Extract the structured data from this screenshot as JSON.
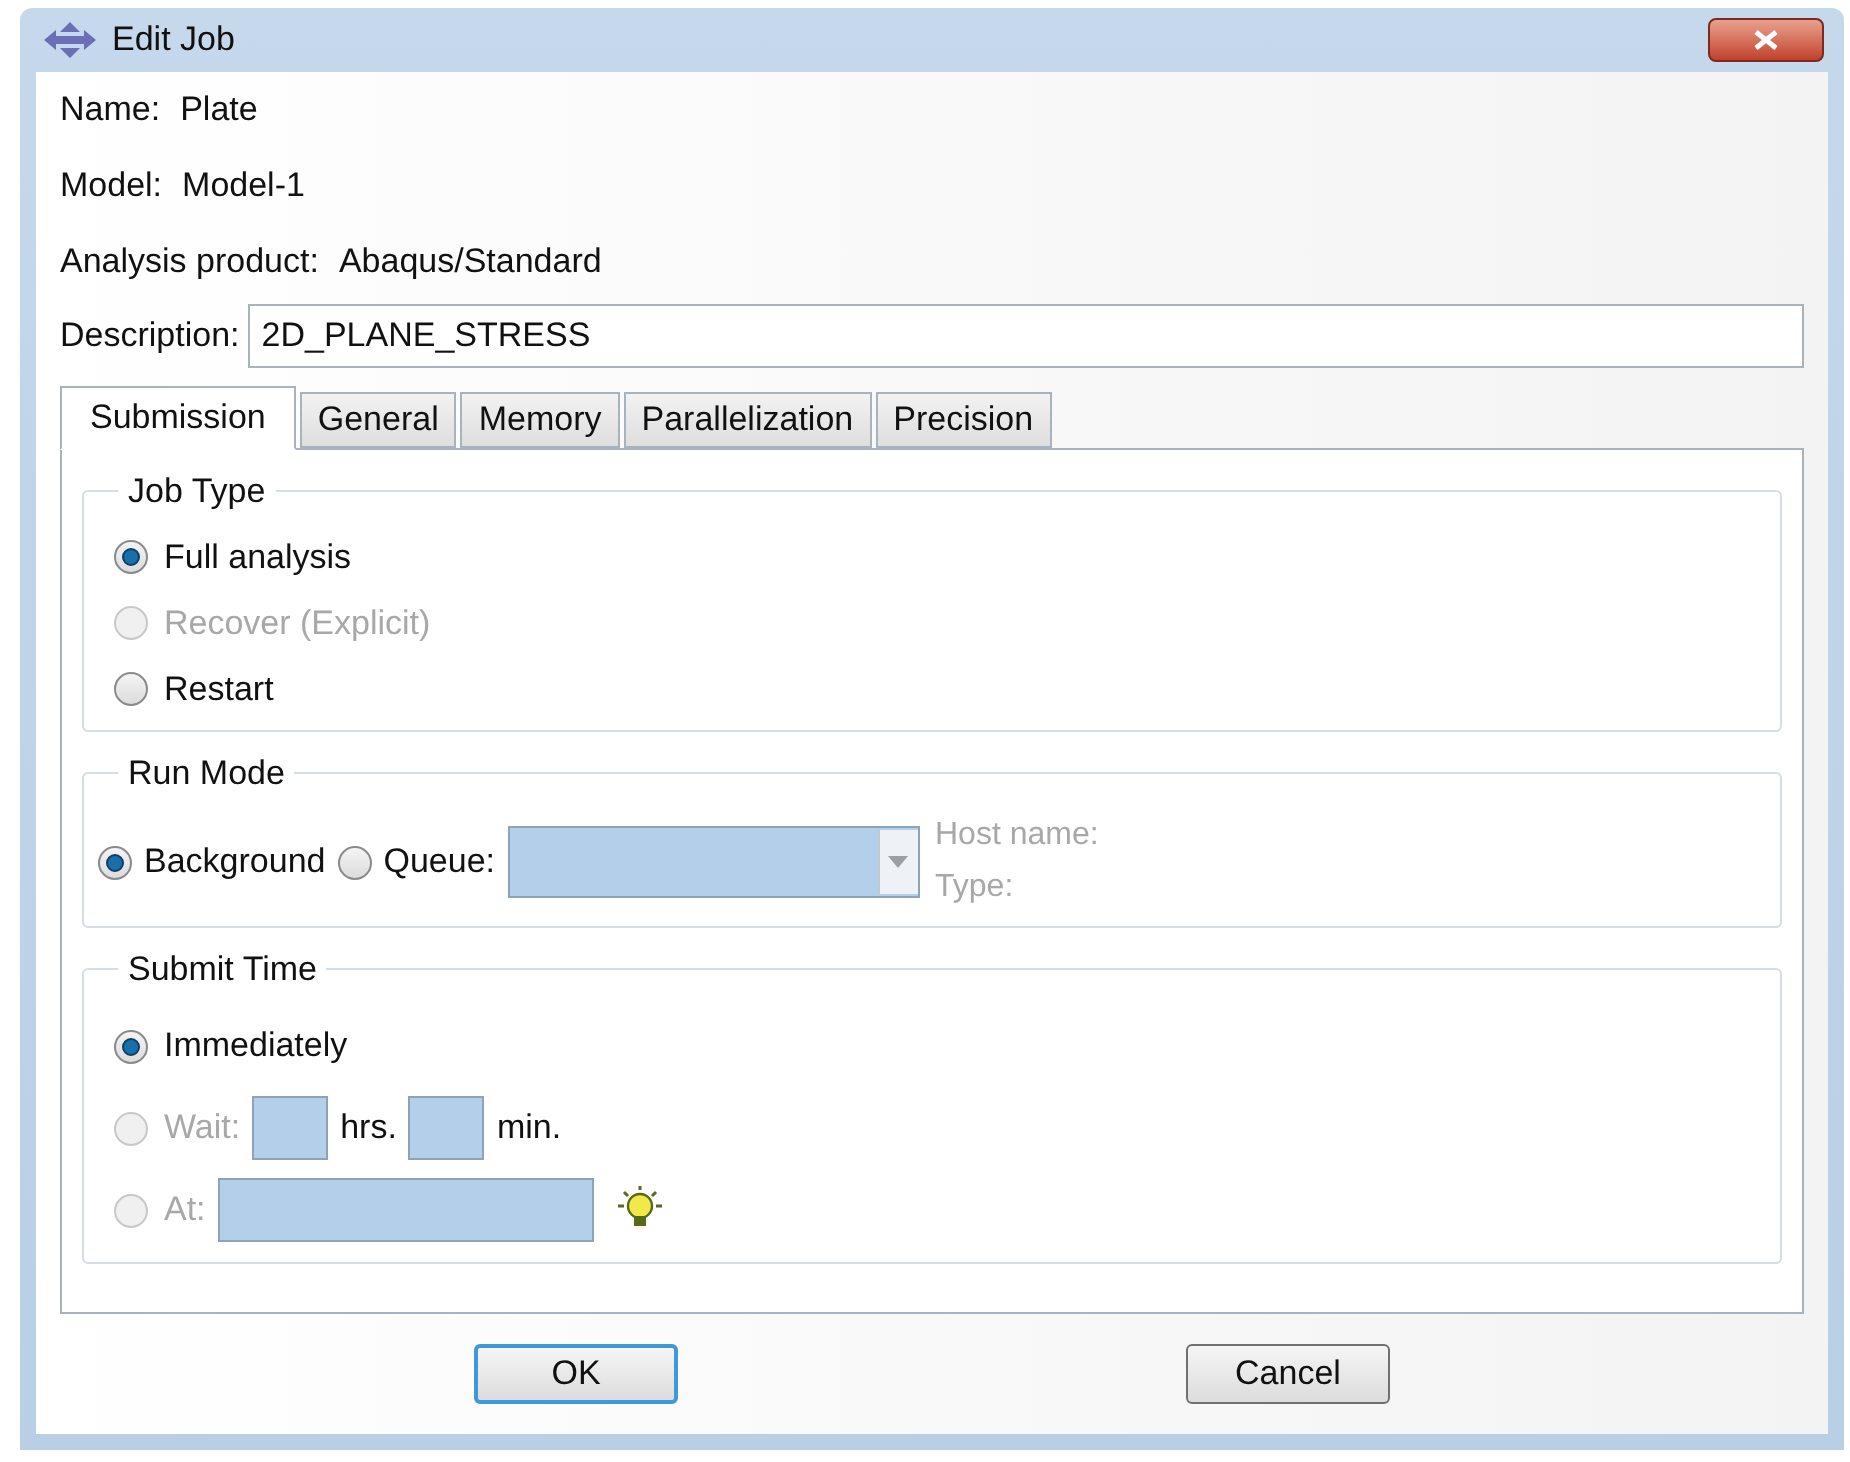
{
  "window": {
    "title": "Edit Job"
  },
  "info": [
    {
      "label": "Name:",
      "value": "Plate"
    },
    {
      "label": "Model:",
      "value": "Model-1"
    },
    {
      "label": "Analysis product:",
      "value": "Abaqus/Standard"
    }
  ],
  "description": {
    "label": "Description:",
    "value": "2D_PLANE_STRESS"
  },
  "tabs": [
    {
      "label": "Submission",
      "selected": true
    },
    {
      "label": "General",
      "selected": false
    },
    {
      "label": "Memory",
      "selected": false
    },
    {
      "label": "Parallelization",
      "selected": false
    },
    {
      "label": "Precision",
      "selected": false
    }
  ],
  "job_type": {
    "title": "Job Type",
    "options": [
      {
        "label": "Full analysis",
        "selected": true,
        "disabled": false
      },
      {
        "label": "Recover (Explicit)",
        "selected": false,
        "disabled": true
      },
      {
        "label": "Restart",
        "selected": false,
        "disabled": false
      }
    ]
  },
  "run_mode": {
    "title": "Run Mode",
    "options": [
      {
        "label": "Background",
        "selected": true,
        "disabled": false
      },
      {
        "label": "Queue:",
        "selected": false,
        "disabled": false
      }
    ],
    "host_labels": [
      "Host name:",
      "Type:"
    ]
  },
  "submit_time": {
    "title": "Submit Time",
    "options": [
      {
        "kind": "plain",
        "label": "Immediately",
        "selected": true,
        "disabled": false
      },
      {
        "kind": "wait",
        "label": "Wait:",
        "selected": false,
        "disabled": true,
        "units": [
          "hrs.",
          "min."
        ]
      },
      {
        "kind": "at",
        "label": "At:",
        "selected": false,
        "disabled": true
      }
    ]
  },
  "buttons": [
    {
      "label": "OK",
      "default": true
    },
    {
      "label": "Cancel",
      "default": false
    }
  ]
}
